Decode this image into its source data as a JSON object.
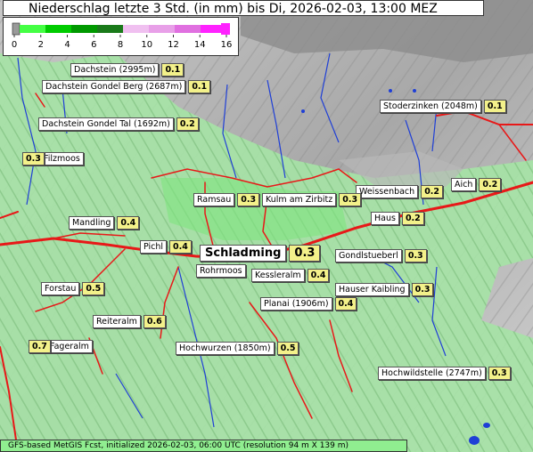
{
  "title": "Niederschlag letzte 3 Std. (in mm) bis Di, 2026-02-03, 13:00 MEZ",
  "legend": {
    "ticks": [
      "0",
      "2",
      "4",
      "6",
      "8",
      "10",
      "12",
      "14",
      "16"
    ],
    "colors": [
      "#9a9a9a",
      "#44ff44",
      "#00cc00",
      "#009900",
      "#1a7a1a",
      "#f0c0f0",
      "#e8a0e8",
      "#e070e0",
      "#ff22ff"
    ]
  },
  "stations": [
    {
      "name": "Dachstein (2995m)",
      "value": "0.1"
    },
    {
      "name": "Dachstein Gondel Berg (2687m)",
      "value": "0.1"
    },
    {
      "name": "Dachstein Gondel Tal (1692m)",
      "value": "0.2"
    },
    {
      "name": "Filzmoos",
      "value": "0.3"
    },
    {
      "name": "Stoderzinken (2048m)",
      "value": "0.1"
    },
    {
      "name": "Aich",
      "value": "0.2"
    },
    {
      "name": "Weissenbach",
      "value": "0.2"
    },
    {
      "name": "Ramsau",
      "value": "0.3"
    },
    {
      "name": "Kulm am Zirbitz",
      "value": "0.3"
    },
    {
      "name": "Haus",
      "value": "0.2"
    },
    {
      "name": "Mandling",
      "value": "0.4"
    },
    {
      "name": "Pichl",
      "value": "0.4"
    },
    {
      "name": "Schladming",
      "value": "0.3"
    },
    {
      "name": "Gondlstueberl",
      "value": "0.3"
    },
    {
      "name": "Rohrmoos",
      "value": ""
    },
    {
      "name": "Kessleralm",
      "value": "0.4"
    },
    {
      "name": "Forstau",
      "value": "0.5"
    },
    {
      "name": "Hauser Kaibling",
      "value": "0.3"
    },
    {
      "name": "Planai (1906m)",
      "value": "0.4"
    },
    {
      "name": "Reiteralm",
      "value": "0.6"
    },
    {
      "name": "Fageralm",
      "value": "0.7"
    },
    {
      "name": "Hochwurzen (1850m)",
      "value": "0.5"
    },
    {
      "name": "Hochwildstelle (2747m)",
      "value": "0.3"
    }
  ],
  "footer": "GFS-based MetGIS Fcst, initialized 2026-02-03, 06:00 UTC  (resolution 94 m X 139 m)"
}
